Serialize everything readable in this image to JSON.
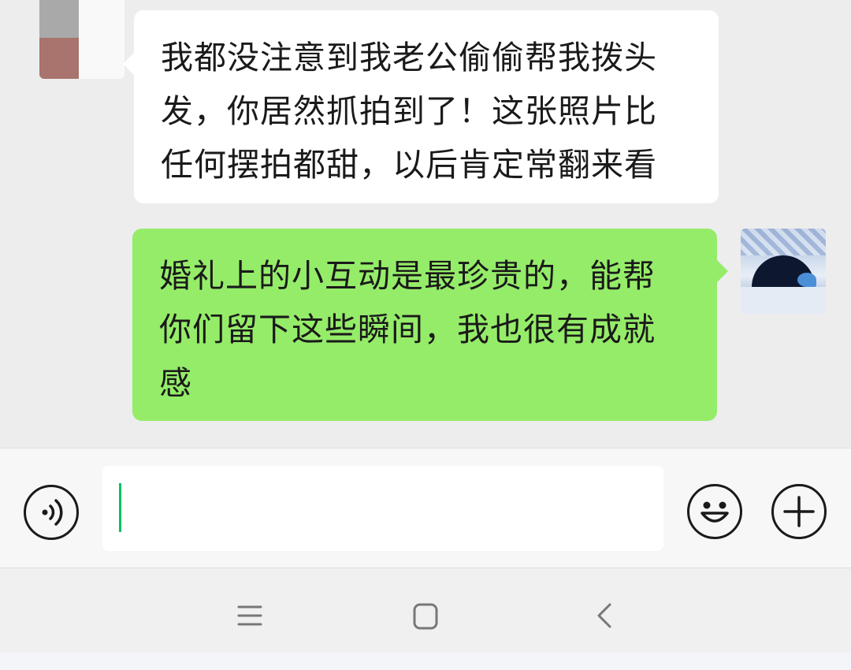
{
  "chat": {
    "messages": [
      {
        "direction": "incoming",
        "lines": [
          "我都没注意到我老公偷偷帮我拨头",
          "发，你居然抓拍到了！这张照片比",
          "任何摆拍都甜，以后肯定常翻来看"
        ]
      },
      {
        "direction": "outgoing",
        "lines": [
          "婚礼上的小互动是最珍贵的，能帮",
          "你们留下这些瞬间，我也很有成就",
          "感"
        ]
      }
    ]
  },
  "input_bar": {
    "text_value": "",
    "voice_icon": "voice-input-icon",
    "emoji_icon": "emoji-icon",
    "plus_icon": "plus-icon"
  },
  "nav_bar": {
    "icons": [
      "menu-icon",
      "home-icon",
      "back-icon"
    ]
  },
  "colors": {
    "chat_background": "#ededed",
    "incoming_bubble": "#ffffff",
    "outgoing_bubble": "#95ec69",
    "caret": "#07c160"
  }
}
